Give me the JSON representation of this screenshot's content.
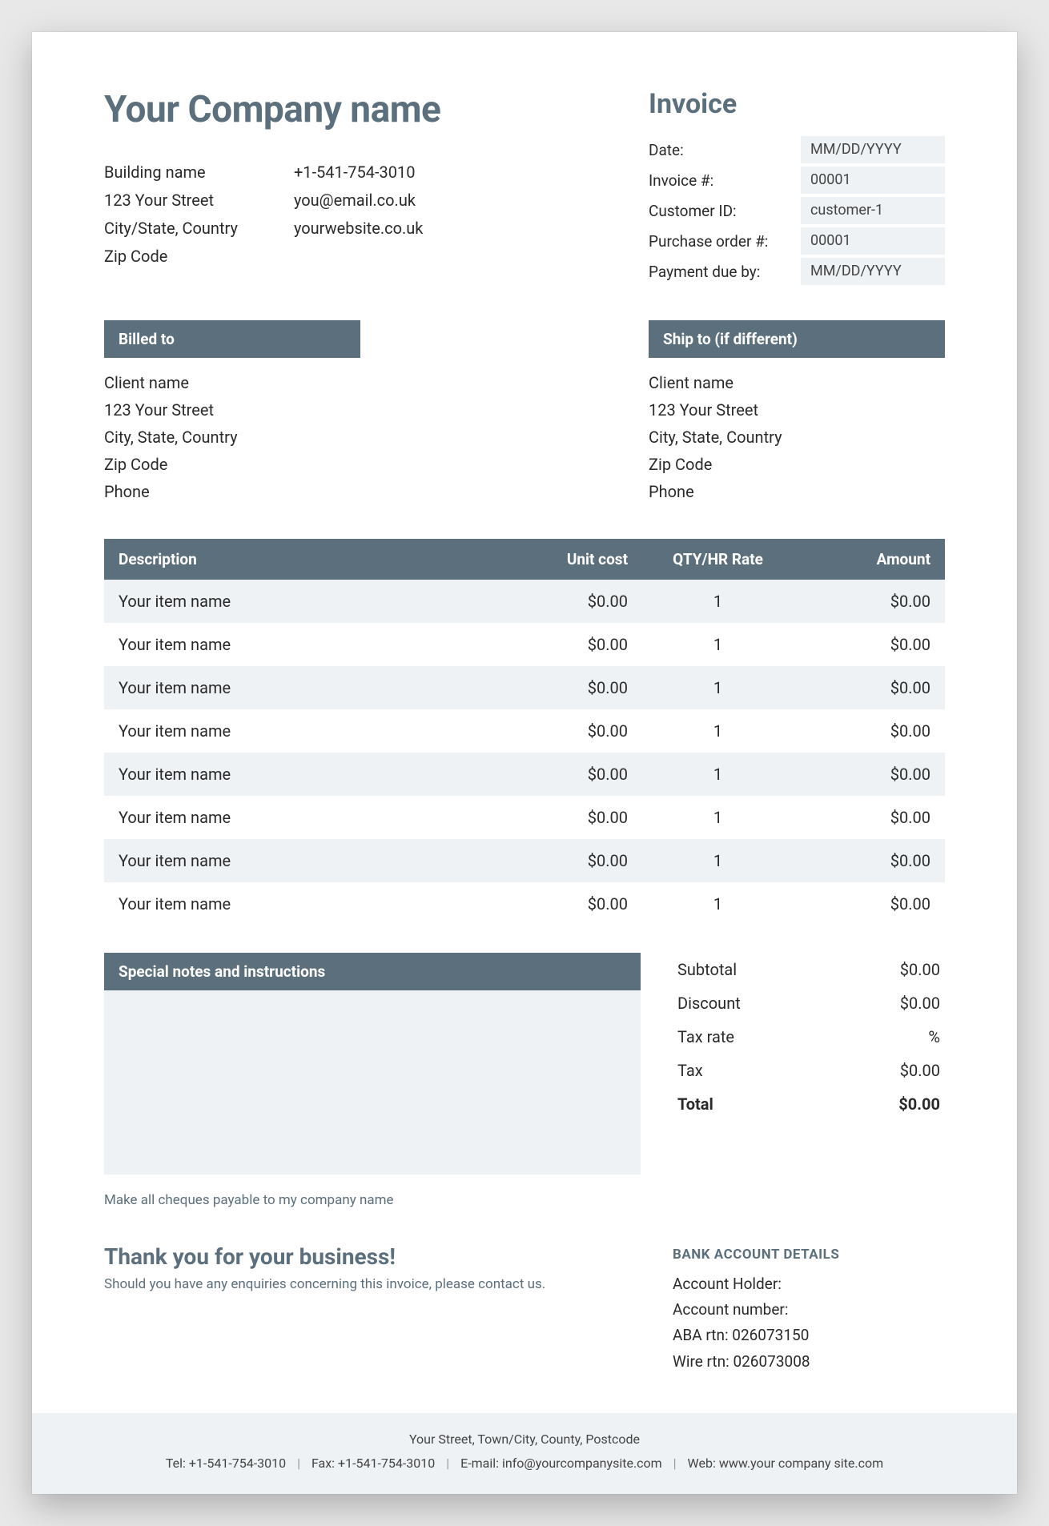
{
  "company": {
    "name": "Your Company name",
    "address": {
      "building": "Building name",
      "street": "123 Your Street",
      "citystate": "City/State, Country",
      "zip": "Zip Code"
    },
    "contact": {
      "phone": "+1-541-754-3010",
      "email": "you@email.co.uk",
      "website": "yourwebsite.co.uk"
    }
  },
  "invoice": {
    "title": "Invoice",
    "meta": [
      {
        "label": "Date:",
        "value": "MM/DD/YYYY"
      },
      {
        "label": "Invoice #:",
        "value": "00001"
      },
      {
        "label": "Customer ID:",
        "value": "customer-1"
      },
      {
        "label": "Purchase order #:",
        "value": "00001"
      },
      {
        "label": "Payment due by:",
        "value": "MM/DD/YYYY"
      }
    ]
  },
  "billed": {
    "heading": "Billed to",
    "lines": [
      "Client name",
      "123 Your Street",
      "City, State, Country",
      "Zip Code",
      "Phone"
    ]
  },
  "ship": {
    "heading": "Ship to (if different)",
    "lines": [
      "Client name",
      "123 Your Street",
      "City, State, Country",
      "Zip Code",
      "Phone"
    ]
  },
  "table": {
    "headers": {
      "desc": "Description",
      "unit": "Unit cost",
      "qty": "QTY/HR Rate",
      "amount": "Amount"
    },
    "rows": [
      {
        "desc": "Your item name",
        "unit": "$0.00",
        "qty": "1",
        "amount": "$0.00"
      },
      {
        "desc": "Your item name",
        "unit": "$0.00",
        "qty": "1",
        "amount": "$0.00"
      },
      {
        "desc": "Your item name",
        "unit": "$0.00",
        "qty": "1",
        "amount": "$0.00"
      },
      {
        "desc": "Your item name",
        "unit": "$0.00",
        "qty": "1",
        "amount": "$0.00"
      },
      {
        "desc": "Your item name",
        "unit": "$0.00",
        "qty": "1",
        "amount": "$0.00"
      },
      {
        "desc": "Your item name",
        "unit": "$0.00",
        "qty": "1",
        "amount": "$0.00"
      },
      {
        "desc": "Your item name",
        "unit": "$0.00",
        "qty": "1",
        "amount": "$0.00"
      },
      {
        "desc": "Your item name",
        "unit": "$0.00",
        "qty": "1",
        "amount": "$0.00"
      }
    ]
  },
  "notes": {
    "heading": "Special notes and instructions",
    "cheque": "Make all cheques payable to my company name"
  },
  "totals": {
    "rows": [
      {
        "label": "Subtotal",
        "value": "$0.00"
      },
      {
        "label": "Discount",
        "value": "$0.00"
      },
      {
        "label": "Tax rate",
        "value": "%"
      },
      {
        "label": "Tax",
        "value": "$0.00"
      }
    ],
    "total": {
      "label": "Total",
      "value": "$0.00"
    }
  },
  "bank": {
    "heading": "BANK ACCOUNT DETAILS",
    "lines": [
      "Account Holder:",
      "Account number:",
      "ABA rtn: 026073150",
      "Wire rtn: 026073008"
    ]
  },
  "thanks": {
    "heading": "Thank you for your business!",
    "line": "Should you have any enquiries concerning this invoice, please contact us."
  },
  "footer": {
    "address": "Your Street, Town/City, County, Postcode",
    "tel_label": "Tel:",
    "tel": "+1-541-754-3010",
    "fax_label": "Fax:",
    "fax": "+1-541-754-3010",
    "email_label": "E-mail:",
    "email": "info@yourcompanysite.com",
    "web_label": "Web:",
    "web": "www.your company site.com"
  }
}
